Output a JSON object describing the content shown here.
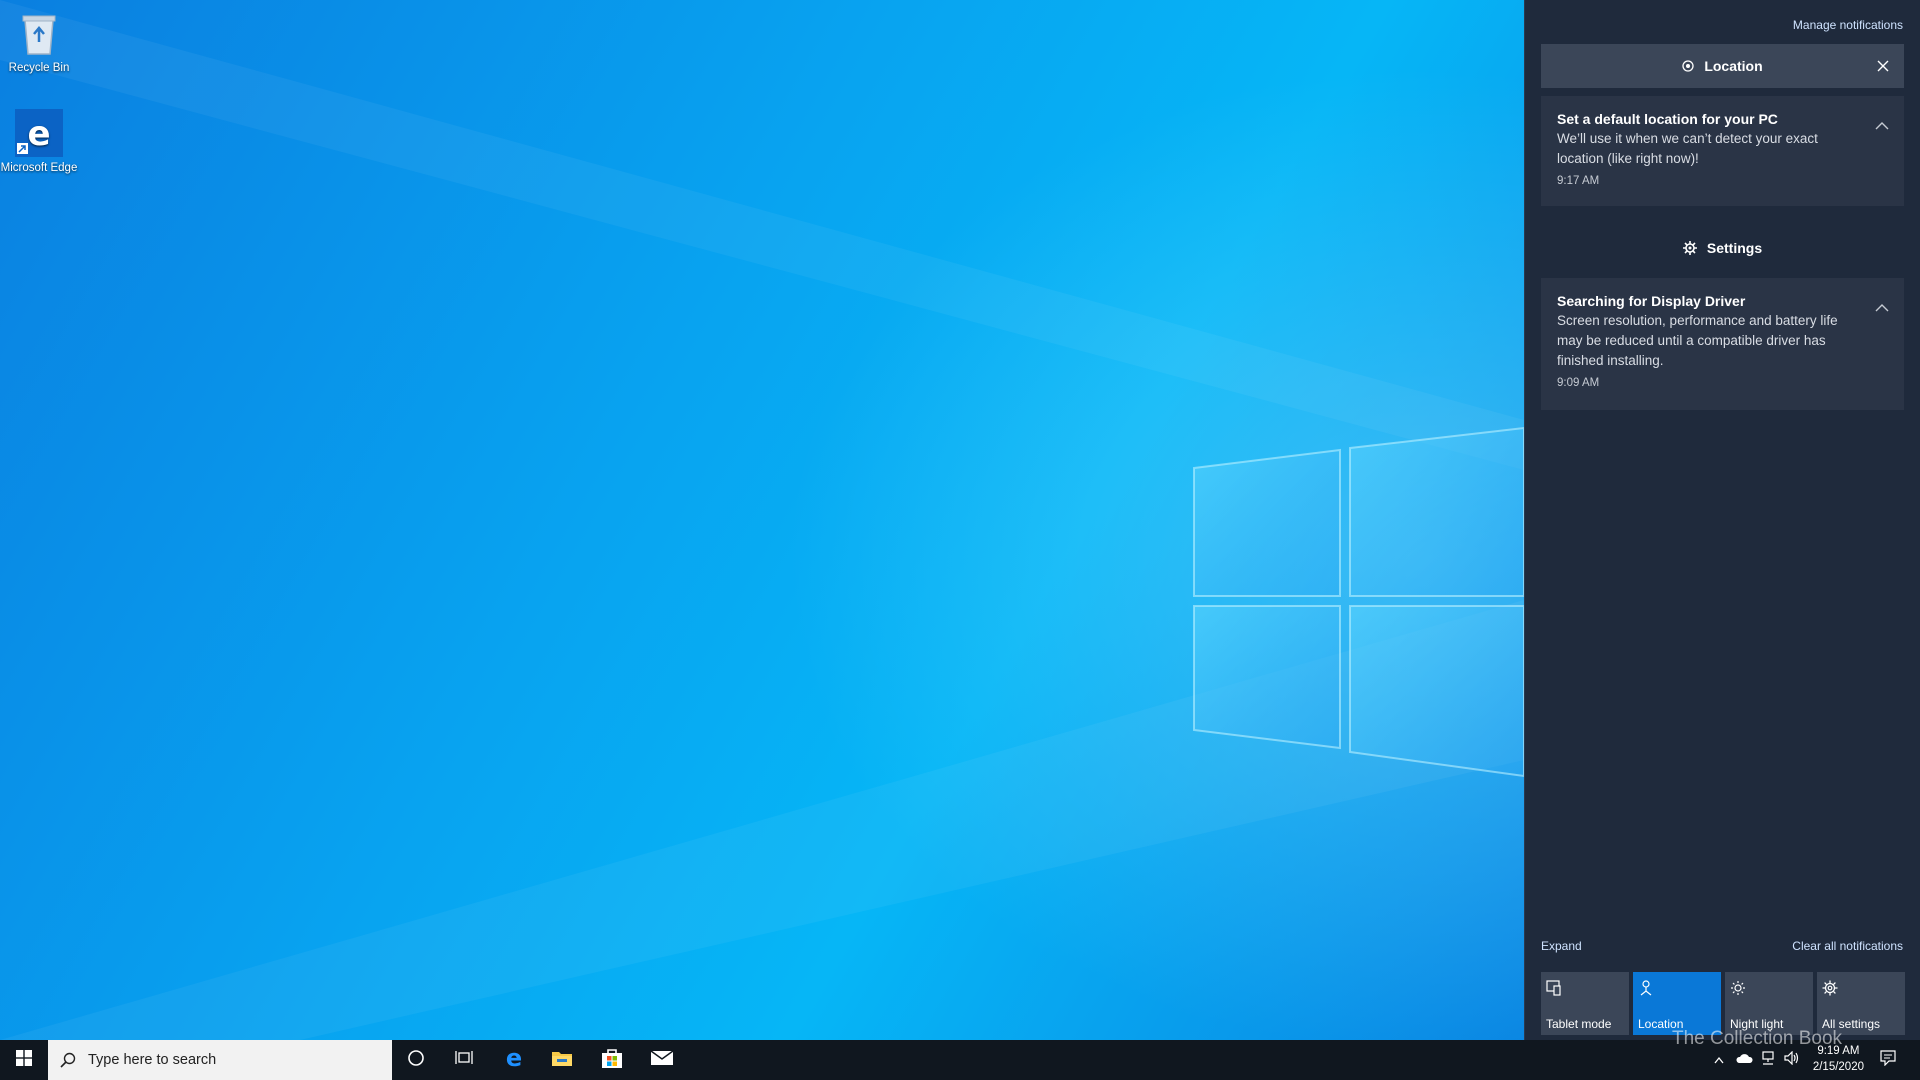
{
  "desktop": {
    "icons": [
      {
        "label": "Recycle Bin",
        "icon": "recycle-bin-icon"
      },
      {
        "label": "Microsoft Edge",
        "icon": "edge-icon"
      }
    ]
  },
  "action_center": {
    "manage_label": "Manage notifications",
    "groups": [
      {
        "app": "Location",
        "icon": "location-icon",
        "notifications": [
          {
            "title": "Set a default location for your PC",
            "body": "We’ll use it when we can’t detect your exact location (like right now)!",
            "time": "9:17 AM"
          }
        ]
      },
      {
        "app": "Settings",
        "icon": "gear-icon",
        "notifications": [
          {
            "title": "Searching for Display Driver",
            "body": "Screen resolution, performance and battery life may be reduced until a compatible driver has finished installing.",
            "time": "9:09 AM"
          }
        ]
      }
    ],
    "expand_label": "Expand",
    "clear_label": "Clear all notifications",
    "quick_actions": [
      {
        "label": "Tablet mode",
        "icon": "tablet-mode-icon",
        "active": false
      },
      {
        "label": "Location",
        "icon": "location-icon",
        "active": true
      },
      {
        "label": "Night light",
        "icon": "night-light-icon",
        "active": false
      },
      {
        "label": "All settings",
        "icon": "gear-icon",
        "active": false
      }
    ]
  },
  "taskbar": {
    "search_placeholder": "Type here to search",
    "pinned": [
      "cortana-icon",
      "task-view-icon",
      "edge-icon",
      "file-explorer-icon",
      "store-icon",
      "mail-icon"
    ],
    "clock": {
      "time": "9:19 AM",
      "date": "2/15/2020"
    }
  },
  "watermark": "The Collection Book",
  "colors": {
    "accent": "#0a78d7",
    "panel": "#1f2a3c",
    "card": "#2a3446",
    "taskbar": "#10171f"
  }
}
